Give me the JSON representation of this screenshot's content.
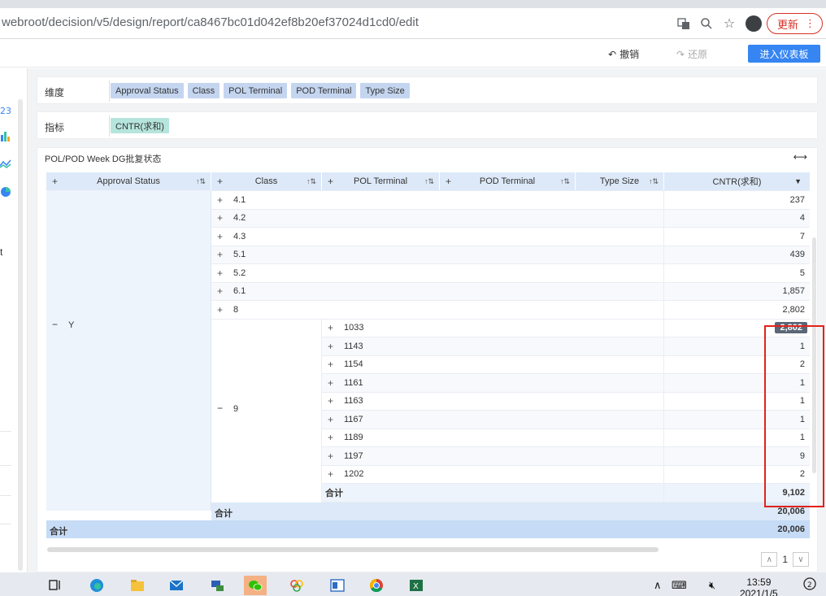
{
  "browser": {
    "url": "webroot/decision/v5/design/report/ca8467bc01d042ef8b20ef37024d1cd0/edit",
    "update_label": "更新"
  },
  "toolbar": {
    "undo_label": "撤销",
    "redo_label": "还原",
    "enter_dashboard_label": "进入仪表板"
  },
  "left_panel": {
    "truncated_text": "t"
  },
  "dimension_bar": {
    "label": "维度",
    "chips": [
      "Approval Status",
      "Class",
      "POL Terminal",
      "POD Terminal",
      "Type Size"
    ]
  },
  "metric_bar": {
    "label": "指标",
    "chips": [
      "CNTR(求和)"
    ]
  },
  "widget": {
    "title": "POL/POD Week DG批复状态",
    "columns": [
      "Approval Status",
      "Class",
      "POL Terminal",
      "POD Terminal",
      "Type Size",
      "CNTR(求和)"
    ],
    "approval_value": "Y",
    "class_rows": [
      {
        "name": "4.1",
        "value": "237"
      },
      {
        "name": "4.2",
        "value": "4"
      },
      {
        "name": "4.3",
        "value": "7"
      },
      {
        "name": "5.1",
        "value": "439"
      },
      {
        "name": "5.2",
        "value": "5"
      },
      {
        "name": "6.1",
        "value": "1,857"
      },
      {
        "name": "8",
        "value": "2,802"
      }
    ],
    "class9": {
      "name": "9",
      "terminals": [
        {
          "name": "1033",
          "value": "2,802"
        },
        {
          "name": "1143",
          "value": "1"
        },
        {
          "name": "1154",
          "value": "2"
        },
        {
          "name": "1161",
          "value": "1"
        },
        {
          "name": "1163",
          "value": "1"
        },
        {
          "name": "1167",
          "value": "1"
        },
        {
          "name": "1189",
          "value": "1"
        },
        {
          "name": "1197",
          "value": "9"
        },
        {
          "name": "1202",
          "value": "2"
        }
      ],
      "subtotal_label": "合计",
      "subtotal_value": "9,102"
    },
    "total_label": "合计",
    "total_value": "20,006",
    "grand_total_label": "合计",
    "grand_total_value": "20,006",
    "page_number": "1"
  },
  "taskbar": {
    "time": "13:59",
    "date": "2021/1/5"
  }
}
